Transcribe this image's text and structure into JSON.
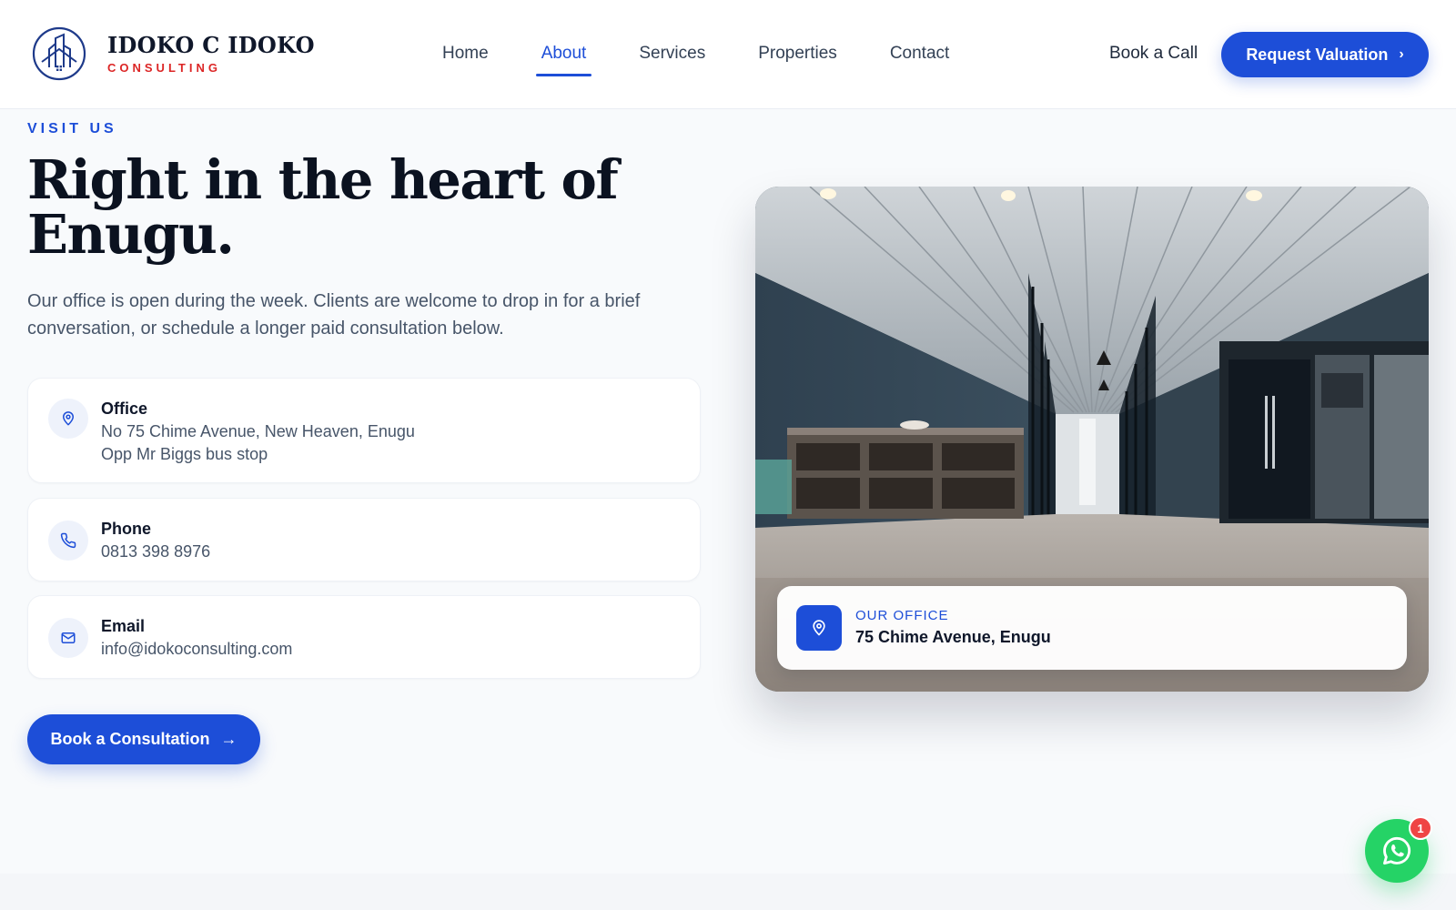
{
  "brand": {
    "name": "IDOKO C IDOKO",
    "tagline": "CONSULTING",
    "accent_color": "#1d4ed8",
    "tagline_color": "#dc2626"
  },
  "nav": {
    "items": [
      {
        "label": "Home",
        "active": false
      },
      {
        "label": "About",
        "active": true
      },
      {
        "label": "Services",
        "active": false
      },
      {
        "label": "Properties",
        "active": false
      },
      {
        "label": "Contact",
        "active": false
      }
    ],
    "book_call": "Book a Call",
    "request_valuation": "Request Valuation"
  },
  "hero": {
    "eyebrow": "VISIT US",
    "headline": "Right in the heart of Enugu.",
    "lead": "Our office is open during the week. Clients are welcome to drop in for a brief conversation, or schedule a longer paid consultation below."
  },
  "contacts": {
    "office": {
      "icon": "map-pin-icon",
      "label": "Office",
      "line1": "No 75 Chime Avenue, New Heaven, Enugu",
      "line2": "Opp Mr Biggs bus stop"
    },
    "phone": {
      "icon": "phone-icon",
      "label": "Phone",
      "value": "0813 398 8976"
    },
    "email": {
      "icon": "mail-icon",
      "label": "Email",
      "value": "info@idokoconsulting.com"
    }
  },
  "cta": {
    "consultation": "Book a Consultation"
  },
  "office_card": {
    "label": "OUR OFFICE",
    "address": "75 Chime Avenue, Enugu"
  },
  "whatsapp": {
    "icon": "whatsapp-icon",
    "badge": "1",
    "color": "#25d366"
  }
}
